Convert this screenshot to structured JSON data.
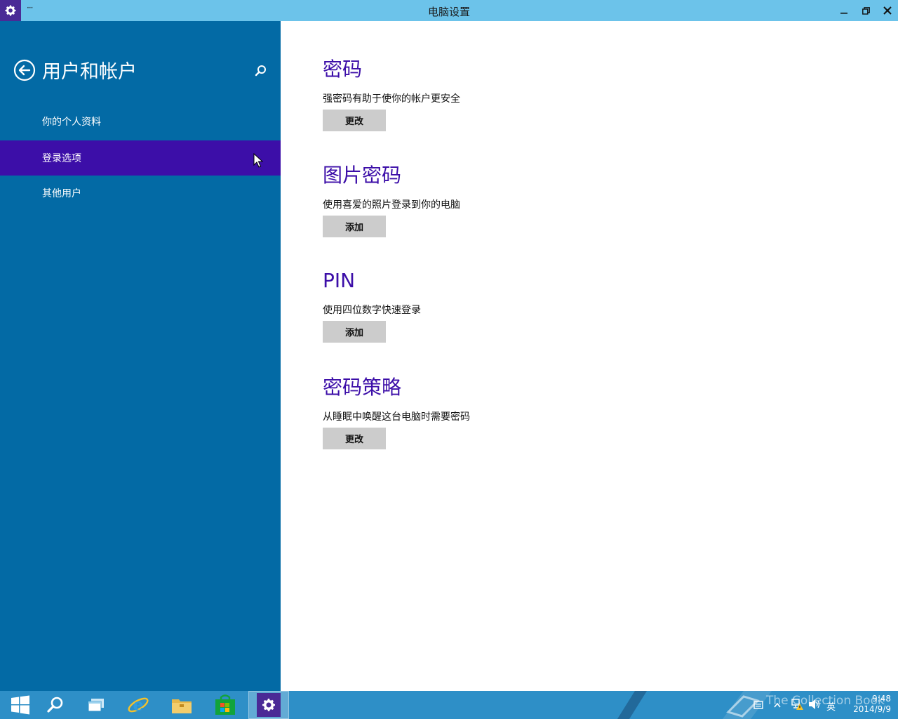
{
  "titlebar": {
    "title": "电脑设置",
    "menu": "···",
    "minimize_icon": "minimize-icon",
    "maximize_icon": "restore-icon",
    "close_icon": "close-icon"
  },
  "sidebar": {
    "title": "用户和帐户",
    "back_icon": "back-arrow-icon",
    "search_icon": "search-icon",
    "items": [
      {
        "label": "你的个人资料",
        "active": false
      },
      {
        "label": "登录选项",
        "active": true
      },
      {
        "label": "其他用户",
        "active": false
      }
    ]
  },
  "main": {
    "groups": [
      {
        "title": "密码",
        "description": "强密码有助于使你的帐户更安全",
        "button": "更改"
      },
      {
        "title": "图片密码",
        "description": "使用喜爱的照片登录到你的电脑",
        "button": "添加"
      },
      {
        "title": "PIN",
        "description": "使用四位数字快速登录",
        "button": "添加"
      },
      {
        "title": "密码策略",
        "description": "从睡眠中唤醒这台电脑时需要密码",
        "button": "更改"
      }
    ]
  },
  "taskbar": {
    "apps": [
      "start",
      "search",
      "task-view",
      "internet-explorer",
      "file-explorer",
      "store",
      "pc-settings"
    ],
    "tray": {
      "ime": "英",
      "time": "9:48",
      "date": "2014/9/9"
    },
    "watermark": "The Collection Book"
  },
  "colors": {
    "titlebar": "#6cc3ea",
    "sidebar": "#036aa5",
    "sidebar_active": "#3c0ea8",
    "heading": "#3c0ea8",
    "button": "#cccccc",
    "taskbar": "#2e8fc7"
  }
}
